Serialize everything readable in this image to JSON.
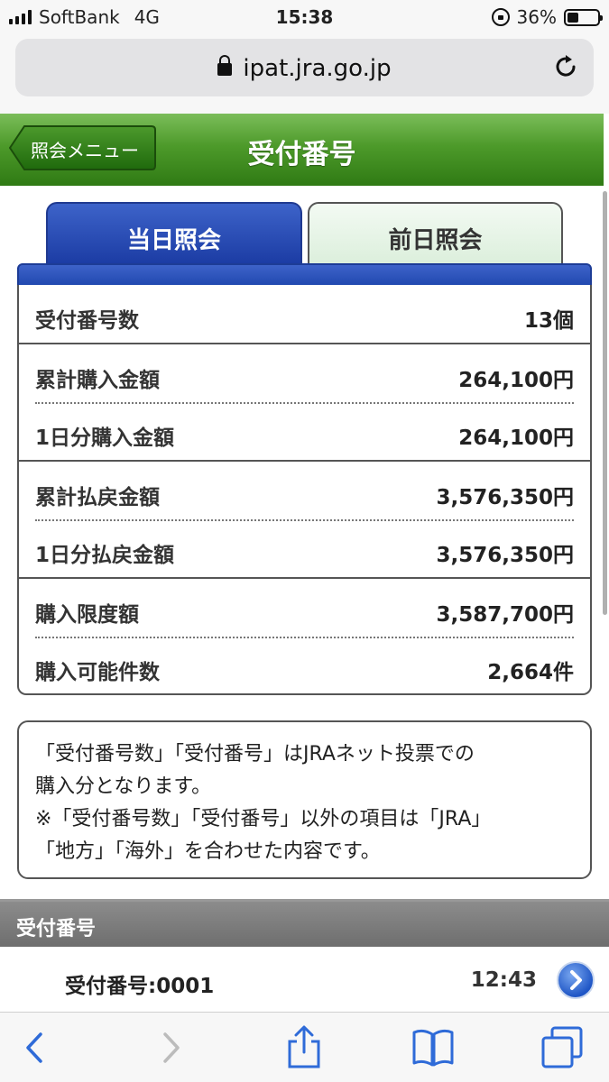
{
  "status_bar": {
    "carrier": "SoftBank",
    "network": "4G",
    "time": "15:38",
    "battery": "36%",
    "battery_level": 0.36
  },
  "browser": {
    "url": "ipat.jra.go.jp"
  },
  "header": {
    "back_label": "照会メニュー",
    "title": "受付番号"
  },
  "tabs": [
    {
      "label": "当日照会",
      "active": true
    },
    {
      "label": "前日照会",
      "active": false
    }
  ],
  "summary": [
    {
      "label": "受付番号数",
      "value": "13個"
    },
    {
      "label": "累計購入金額",
      "value": "264,100円"
    },
    {
      "label": "1日分購入金額",
      "value": "264,100円"
    },
    {
      "label": "累計払戻金額",
      "value": "3,576,350円"
    },
    {
      "label": "1日分払戻金額",
      "value": "3,576,350円"
    },
    {
      "label": "購入限度額",
      "value": "3,587,700円"
    },
    {
      "label": "購入可能件数",
      "value": "2,664件"
    }
  ],
  "notes": {
    "line1": "「受付番号数」「受付番号」はJRAネット投票での",
    "line2": "購入分となります。",
    "line3": "※「受付番号数」「受付番号」以外の項目は「JRA」",
    "line4": "「地方」「海外」を合わせた内容です。"
  },
  "section": {
    "title": "受付番号"
  },
  "list": [
    {
      "title": "受付番号:0001",
      "time": "12:43"
    }
  ],
  "colors": {
    "header_green": "#4d9a2a",
    "tab_active_blue": "#1a3aa2",
    "ios_blue": "#2f6bd8"
  }
}
